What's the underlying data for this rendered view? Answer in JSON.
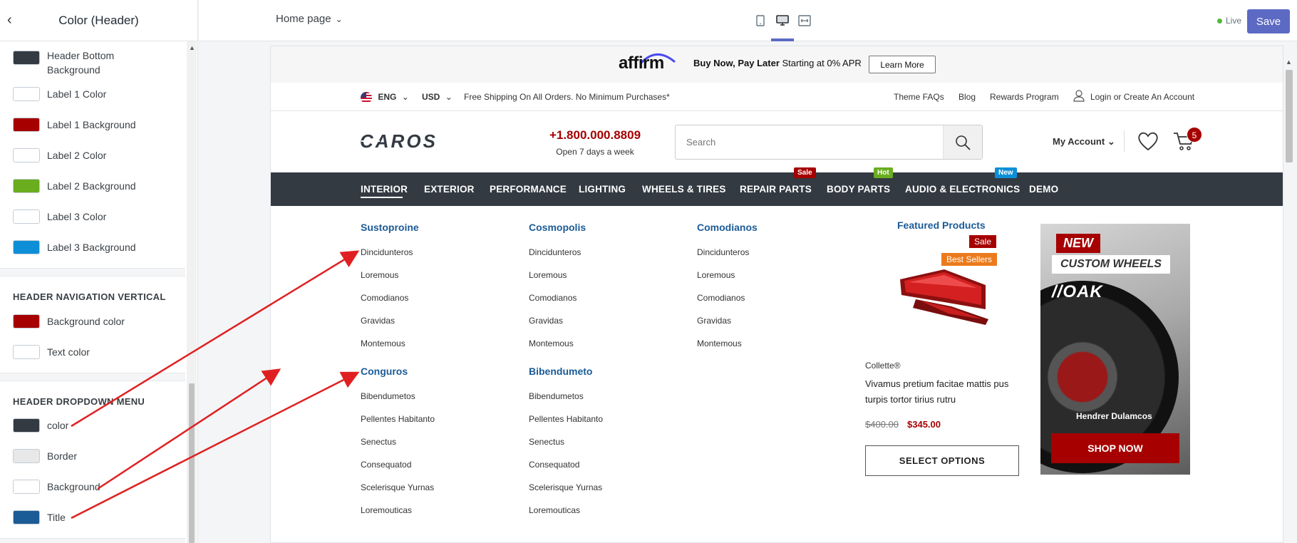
{
  "editor": {
    "panel_title": "Color (Header)",
    "swatches_top": [
      {
        "label": "Header Bottom Background",
        "color": "#333a42"
      },
      {
        "label": "Label 1 Color",
        "color": "#ffffff"
      },
      {
        "label": "Label 1 Background",
        "color": "#a60000"
      },
      {
        "label": "Label 2 Color",
        "color": "#ffffff"
      },
      {
        "label": "Label 2 Background",
        "color": "#6aad1f"
      },
      {
        "label": "Label 3 Color",
        "color": "#ffffff"
      },
      {
        "label": "Label 3 Background",
        "color": "#0d8fd8"
      }
    ],
    "section_vertical": {
      "title": "HEADER NAVIGATION VERTICAL",
      "swatches": [
        {
          "label": "Background color",
          "color": "#a60000"
        },
        {
          "label": "Text color",
          "color": "#ffffff"
        }
      ]
    },
    "section_dropdown": {
      "title": "HEADER DROPDOWN MENU",
      "swatches": [
        {
          "label": "color",
          "color": "#333a42"
        },
        {
          "label": "Border",
          "color": "#e8e8e8"
        },
        {
          "label": "Background",
          "color": "#ffffff"
        },
        {
          "label": "Title",
          "color": "#1b5b96"
        }
      ]
    }
  },
  "topbar": {
    "page_select": "Home page",
    "live_label": "Live",
    "save_label": "Save"
  },
  "store": {
    "affirm": {
      "logo": "affirm",
      "bold_text": "Buy Now, Pay Later",
      "text": " Starting at 0% APR",
      "button": "Learn More"
    },
    "utility": {
      "language": "ENG",
      "currency": "USD",
      "shipping": "Free Shipping On All Orders. No Minimum Purchases*",
      "links": [
        "Theme FAQs",
        "Blog",
        "Rewards Program"
      ],
      "account_link": "Login or Create An Account"
    },
    "brand": "CAROS",
    "phone": {
      "number": "+1.800.000.8809",
      "hours": "Open 7 days a week"
    },
    "search_placeholder": "Search",
    "my_account": "My Account",
    "cart_count": "5",
    "nav": {
      "items": [
        "INTERIOR",
        "EXTERIOR",
        "PERFORMANCE",
        "LIGHTING",
        "WHEELS & TIRES",
        "REPAIR PARTS",
        "BODY PARTS",
        "AUDIO & ELECTRONICS",
        "DEMO"
      ],
      "badges": [
        {
          "text": "Sale",
          "color": "#a60000"
        },
        {
          "text": "Hot",
          "color": "#6aad1f"
        },
        {
          "text": "New",
          "color": "#0d8fd8"
        }
      ]
    },
    "dropdown": {
      "columns": [
        {
          "title": "Sustoproine",
          "links": [
            "Dincidunteros",
            "Loremous",
            "Comodianos",
            "Gravidas",
            "Montemous"
          ]
        },
        {
          "title": "Cosmopolis",
          "links": [
            "Dincidunteros",
            "Loremous",
            "Comodianos",
            "Gravidas",
            "Montemous"
          ]
        },
        {
          "title": "Comodianos",
          "links": [
            "Dincidunteros",
            "Loremous",
            "Comodianos",
            "Gravidas",
            "Montemous"
          ]
        },
        {
          "title": "Conguros",
          "links": [
            "Bibendumetos",
            "Pellentes Habitanto",
            "Senectus",
            "Consequatod",
            "Scelerisque Yurnas",
            "Loremouticas"
          ]
        },
        {
          "title": "Bibendumeto",
          "links": [
            "Bibendumetos",
            "Pellentes Habitanto",
            "Senectus",
            "Consequatod",
            "Scelerisque Yurnas",
            "Loremouticas"
          ]
        }
      ],
      "featured": {
        "title": "Featured Products",
        "badge_sale": "Sale",
        "badge_best": "Best Sellers",
        "vendor": "Collette®",
        "name": "Vivamus pretium facitae mattis pus turpis tortor tirius rutru",
        "old_price": "$400.00",
        "new_price": "$345.00",
        "button": "SELECT OPTIONS"
      },
      "banner": {
        "tag": "NEW",
        "headline": "CUSTOM WHEELS",
        "brand": "//OAK",
        "caption": "Hendrer Dulamcos",
        "button": "SHOP NOW"
      }
    }
  }
}
